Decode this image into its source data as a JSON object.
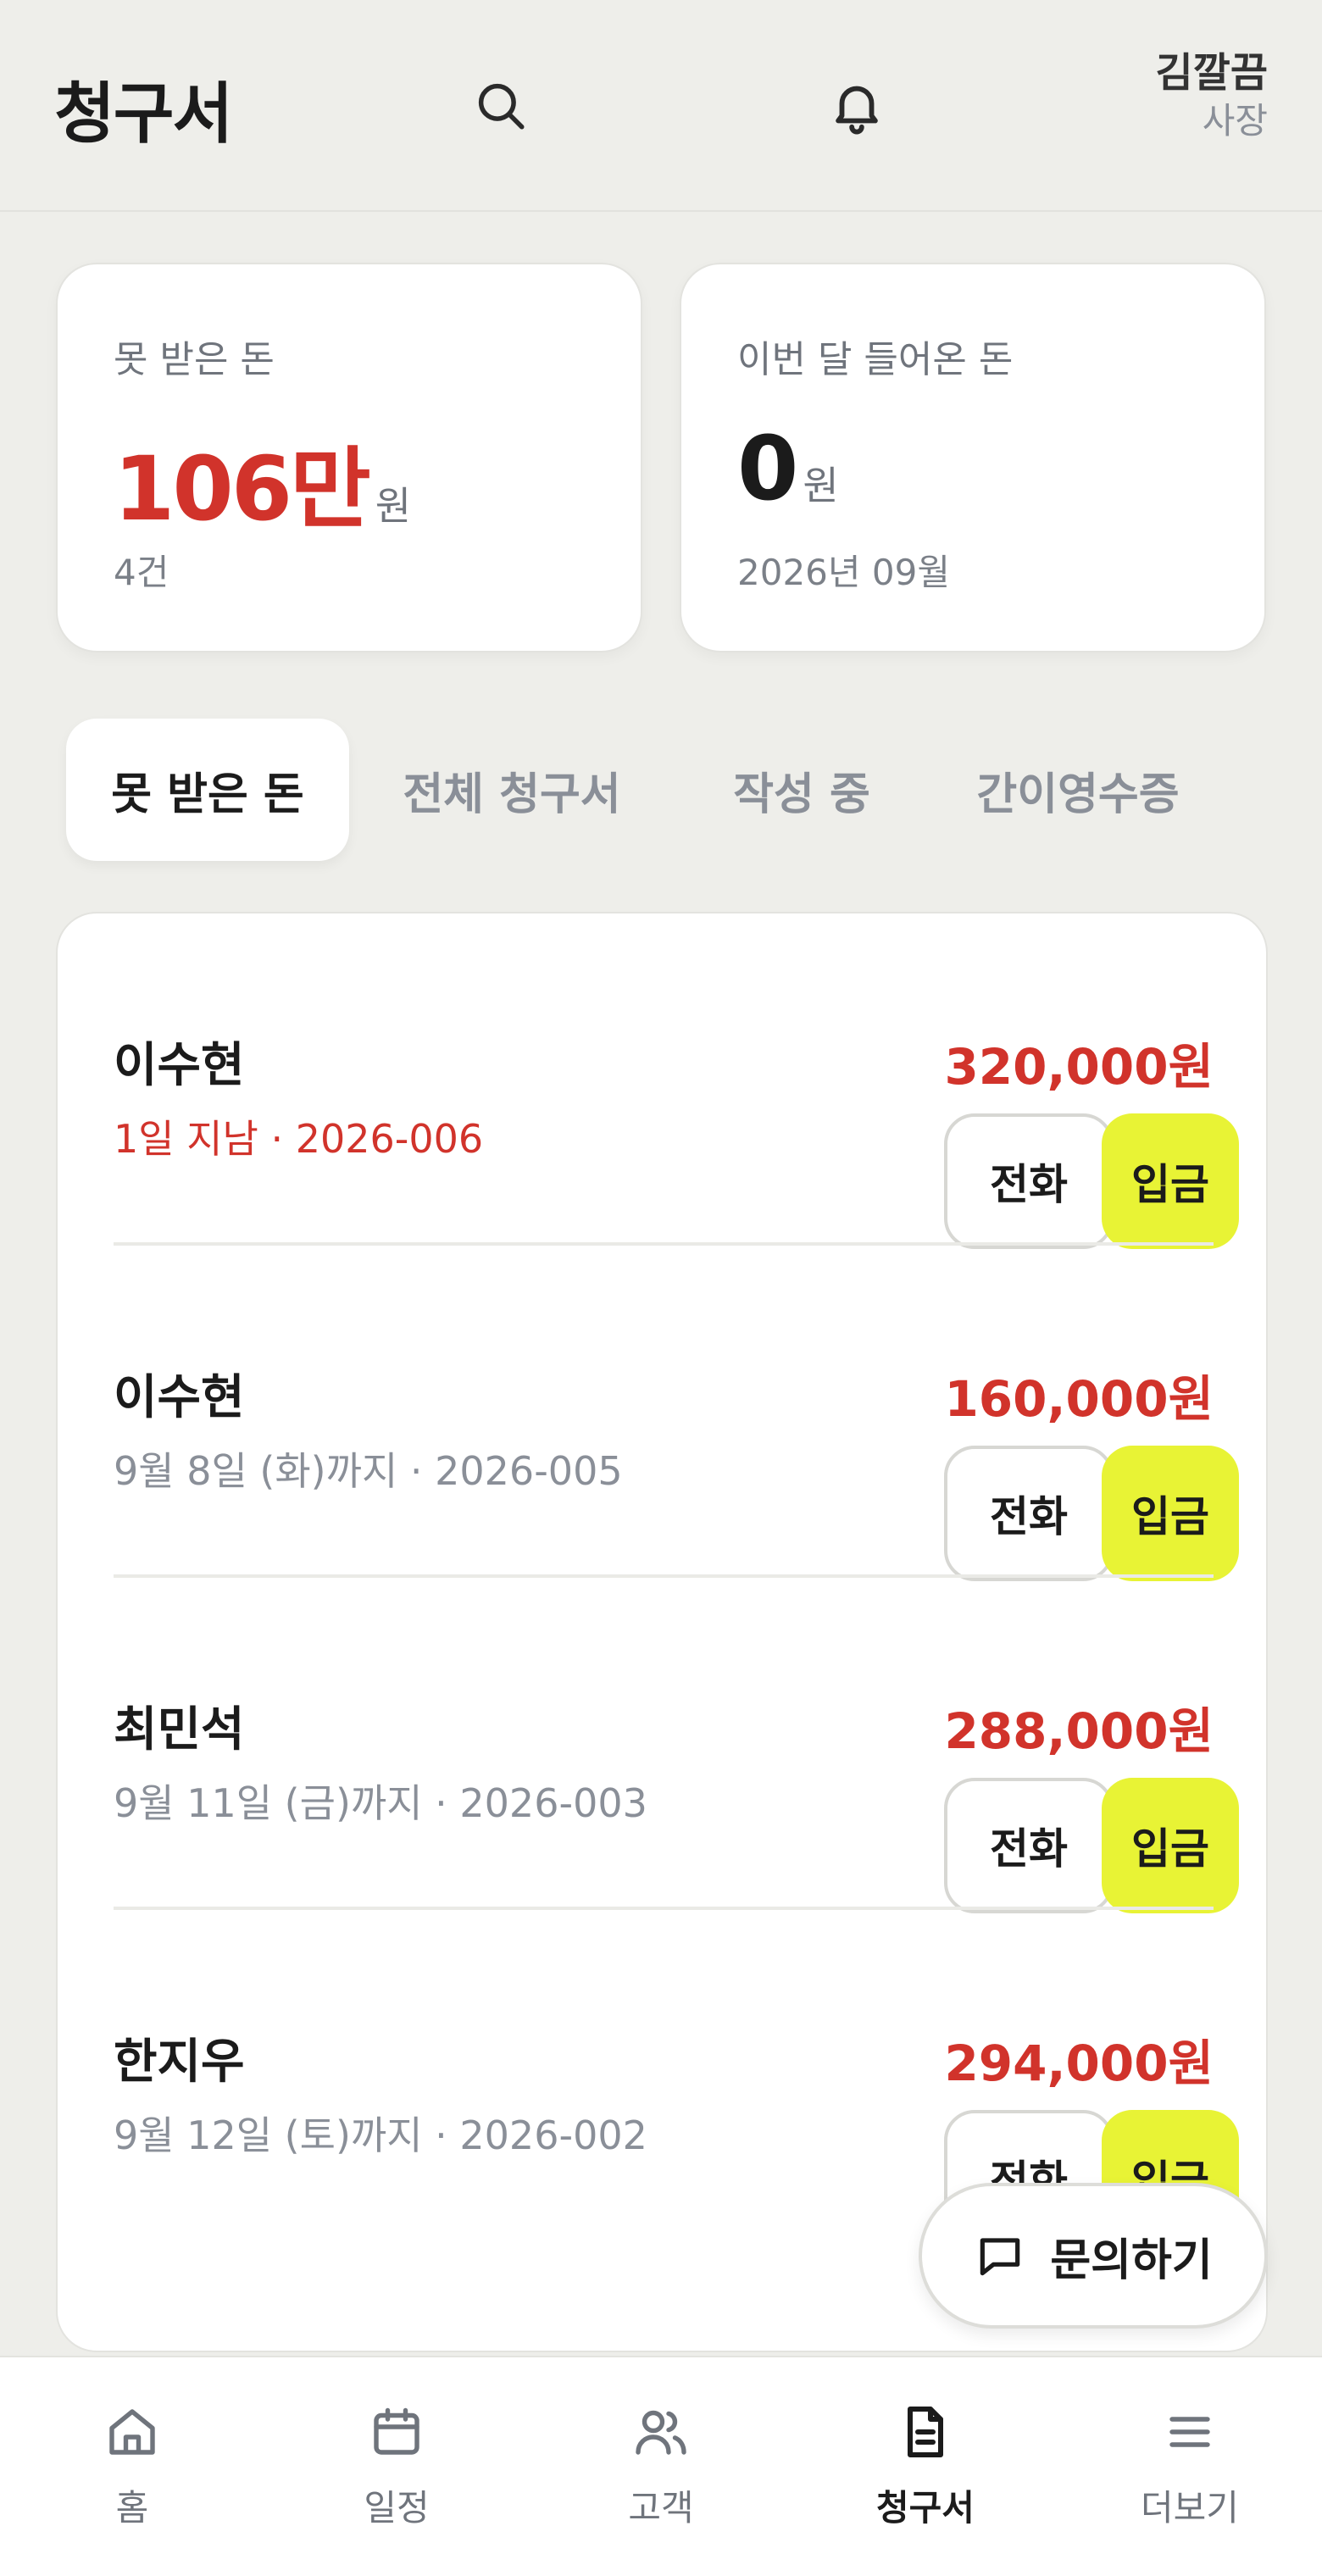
{
  "header": {
    "title": "청구서",
    "user_name": "김깔끔",
    "user_role": "사장"
  },
  "summary": {
    "unpaid": {
      "label": "못 받은 돈",
      "amount": "106만",
      "unit": "원",
      "count": "4건",
      "color": "#D1332B"
    },
    "income": {
      "label": "이번 달 들어온 돈",
      "amount": "0",
      "unit": "원",
      "period": "2026년 09월",
      "color": "#1b1b1b"
    }
  },
  "tabs": [
    {
      "label": "못 받은 돈",
      "active": true
    },
    {
      "label": "전체 청구서",
      "active": false
    },
    {
      "label": "작성 중",
      "active": false
    },
    {
      "label": "간이영수증",
      "active": false
    }
  ],
  "invoices": [
    {
      "name": "이수현",
      "meta": "1일 지남 · 2026-006",
      "overdue": true,
      "amount": "320,000원"
    },
    {
      "name": "이수현",
      "meta": "9월 8일 (화)까지 · 2026-005",
      "overdue": false,
      "amount": "160,000원"
    },
    {
      "name": "최민석",
      "meta": "9월 11일 (금)까지 · 2026-003",
      "overdue": false,
      "amount": "288,000원"
    },
    {
      "name": "한지우",
      "meta": "9월 12일 (토)까지 · 2026-002",
      "overdue": false,
      "amount": "294,000원"
    }
  ],
  "actions": {
    "call_label": "전화",
    "deposit_label": "입금"
  },
  "chat": {
    "label": "문의하기",
    "icon": "chat-bubble-icon"
  },
  "nav": [
    {
      "label": "홈",
      "icon": "home-icon",
      "active": false
    },
    {
      "label": "일정",
      "icon": "calendar-icon",
      "active": false
    },
    {
      "label": "고객",
      "icon": "users-icon",
      "active": false
    },
    {
      "label": "청구서",
      "icon": "document-icon",
      "active": true
    },
    {
      "label": "더보기",
      "icon": "menu-icon",
      "active": false
    }
  ],
  "colors": {
    "accent_red": "#D1332B",
    "deposit_yellow": "#E8F335",
    "background": "#EEEEEA"
  }
}
